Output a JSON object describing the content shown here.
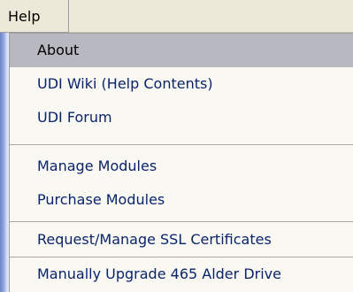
{
  "menubar": {
    "help_label": "Help"
  },
  "menu": {
    "items": [
      {
        "label": "About"
      },
      {
        "label": "UDI Wiki (Help Contents)"
      },
      {
        "label": "UDI Forum"
      },
      {
        "label": "Manage Modules"
      },
      {
        "label": "Purchase Modules"
      },
      {
        "label": "Request/Manage SSL Certificates"
      },
      {
        "label": "Manually Upgrade 465 Alder Drive"
      }
    ],
    "highlight_color": "#b8b8c0",
    "text_color": "#0a246a"
  }
}
